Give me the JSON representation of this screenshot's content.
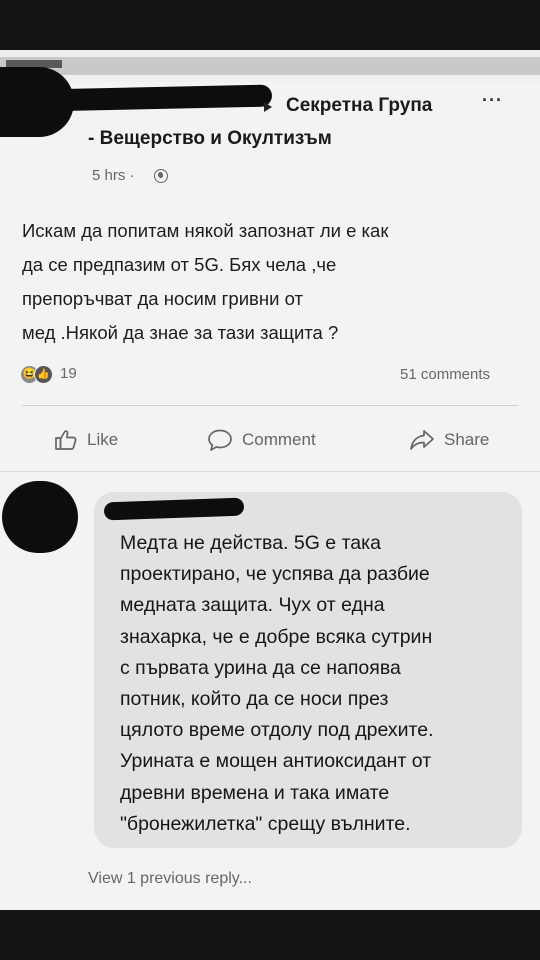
{
  "post": {
    "group_name_line1": "Секретна Група",
    "group_name_line2": "- Вещерство и Окултизъм",
    "time": "5 hrs ·",
    "text_lines": [
      "Искам да попитам някой запознат ли е как",
      "да се предпазим от 5G. Бях чела ,че",
      "препоръчват да носим гривни от",
      "мед .Някой да знае за тази защита ?"
    ],
    "reaction_count": "19",
    "comments_count": "51 comments",
    "more_label": "···"
  },
  "actions": {
    "like": "Like",
    "comment": "Comment",
    "share": "Share"
  },
  "comment": {
    "text_lines": [
      "Медта не действа. 5G е така",
      "проектирано, че успява да разбие",
      "медната защита. Чух от една",
      "знахарка, че е добре всяка сутрин",
      "с първата урина да се напоява",
      "потник, който да се носи през",
      "цялото време отдолу под дрехите.",
      "Урината е мощен антиоксидант от",
      "древни времена и така имате",
      "\"бронежилетка\" срещу вълните."
    ],
    "view_replies": "View 1 previous reply..."
  },
  "icons": {
    "reaction_1": "haha-reaction-icon",
    "reaction_2": "like-reaction-icon",
    "like": "thumbs-up-icon",
    "comment": "speech-bubble-icon",
    "share": "share-arrow-icon",
    "privacy": "globe-icon",
    "breadcrumb": "triangle-right-icon"
  },
  "colors": {
    "background": "#f3f3f3",
    "comment_bubble": "#e2e2e2",
    "frame": "#141414",
    "muted_text": "#666666"
  }
}
